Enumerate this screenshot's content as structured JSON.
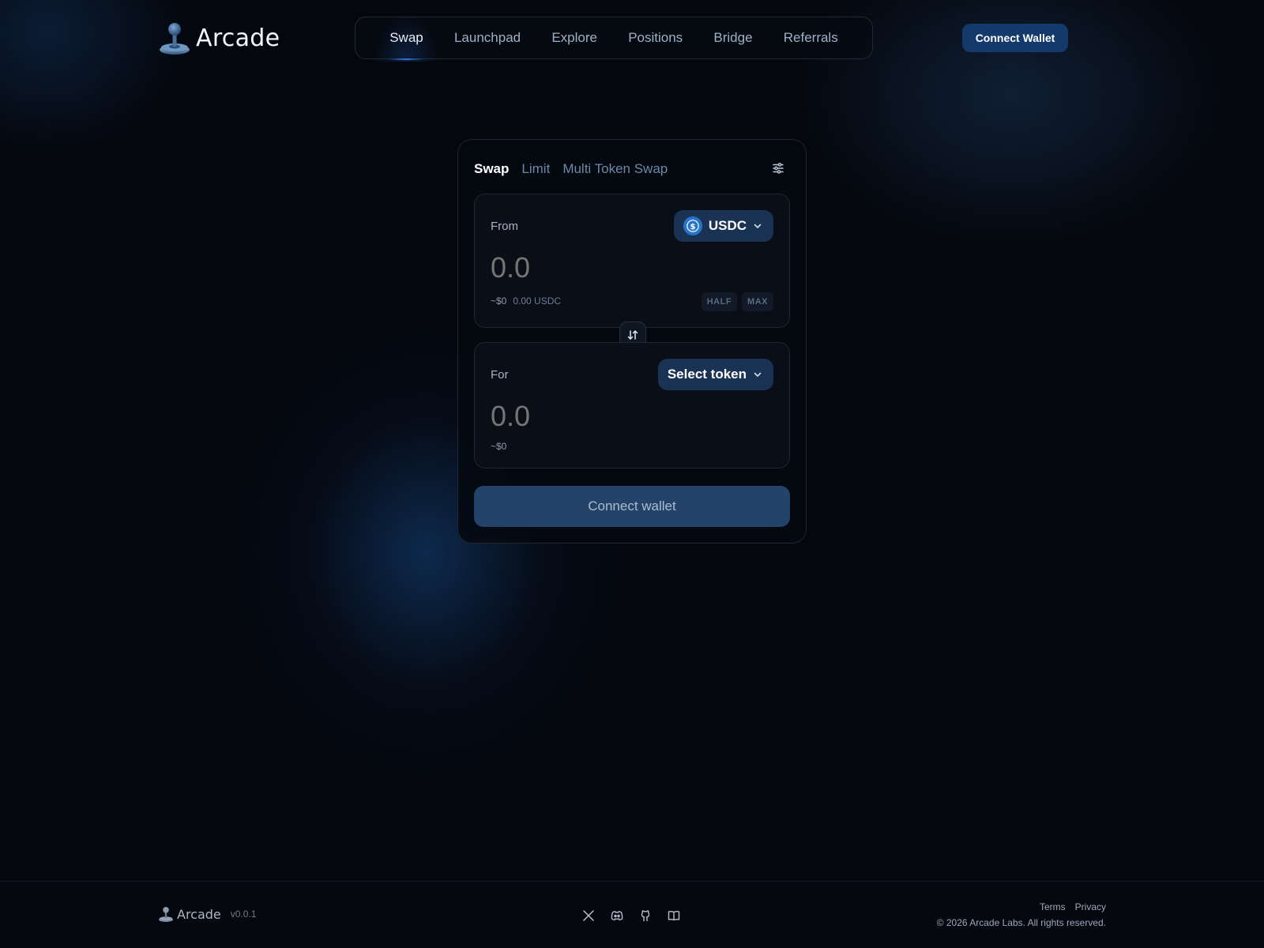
{
  "brand": {
    "name": "Arcade",
    "version": "v0.0.1"
  },
  "nav": {
    "items": [
      {
        "label": "Swap",
        "active": true
      },
      {
        "label": "Launchpad"
      },
      {
        "label": "Explore"
      },
      {
        "label": "Positions"
      },
      {
        "label": "Bridge"
      },
      {
        "label": "Referrals"
      }
    ],
    "connect_label": "Connect Wallet"
  },
  "swap": {
    "tabs": [
      {
        "label": "Swap",
        "active": true
      },
      {
        "label": "Limit"
      },
      {
        "label": "Multi Token Swap"
      }
    ],
    "from": {
      "label": "From",
      "token": "USDC",
      "amount_placeholder": "0.0",
      "usd": "~$0",
      "balance": "0.00 USDC",
      "half_label": "HALF",
      "max_label": "MAX"
    },
    "to": {
      "label": "For",
      "token": "Select token",
      "amount_placeholder": "0.0",
      "usd": "~$0"
    },
    "connect_label": "Connect wallet"
  },
  "footer": {
    "socials": [
      "x-icon",
      "discord-icon",
      "github-icon",
      "docs-book-icon"
    ],
    "links": [
      "Terms",
      "Privacy"
    ],
    "copyright": "© 2026 Arcade Labs. All rights reserved."
  },
  "colors": {
    "background": "#04070d",
    "accent": "#143a6b",
    "usdc_blue": "#2775ca"
  }
}
